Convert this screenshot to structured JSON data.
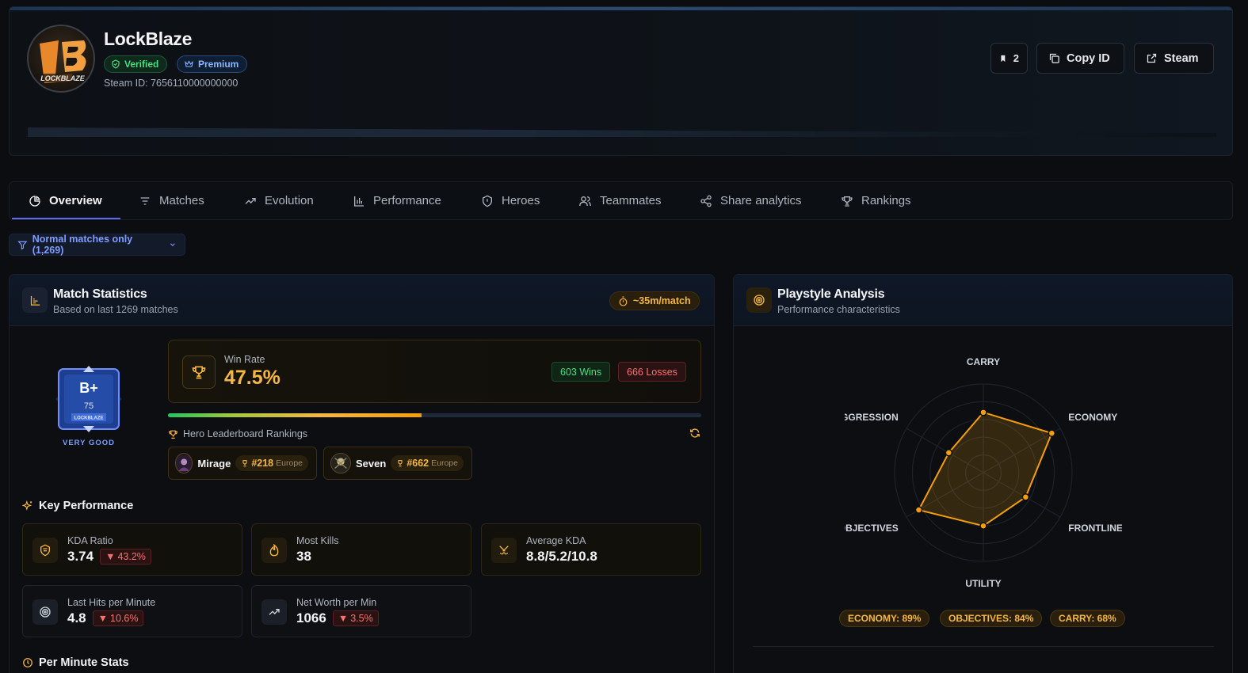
{
  "profile": {
    "name": "LockBlaze",
    "avatar_text": "LB",
    "badges": {
      "verified": "Verified",
      "premium": "Premium"
    },
    "steam_id": "Steam ID: 7656110000000000"
  },
  "header_buttons": {
    "bookmark_count": "2",
    "copy_id": "Copy ID",
    "steam": "Steam"
  },
  "tabs": [
    "Overview",
    "Matches",
    "Evolution",
    "Performance",
    "Heroes",
    "Teammates",
    "Share analytics",
    "Rankings"
  ],
  "filter": {
    "label": "Normal matches only (1,269)"
  },
  "match_stats": {
    "title": "Match Statistics",
    "subtitle": "Based on last 1269 matches",
    "avg_time": "~35m/match",
    "rank": {
      "grade": "B+",
      "score": "75",
      "label": "VERY GOOD"
    },
    "win_rate": {
      "label": "Win Rate",
      "value": "47.5%",
      "fraction": 0.475,
      "wins": "603 Wins",
      "losses": "666 Losses"
    },
    "leaderboard": {
      "title": "Hero Leaderboard Rankings",
      "heroes": [
        {
          "name": "Mirage",
          "rank": "#218",
          "region": "Europe"
        },
        {
          "name": "Seven",
          "rank": "#662",
          "region": "Europe"
        }
      ]
    },
    "key_performance": {
      "title": "Key Performance",
      "stats": [
        {
          "label": "KDA Ratio",
          "value": "3.74",
          "delta": "43.2%"
        },
        {
          "label": "Most Kills",
          "value": "38",
          "delta": ""
        },
        {
          "label": "Average KDA",
          "value": "8.8/5.2/10.8",
          "delta": ""
        },
        {
          "label": "Last Hits per Minute",
          "value": "4.8",
          "delta": "10.6%"
        },
        {
          "label": "Net Worth per Min",
          "value": "1066",
          "delta": "3.5%"
        }
      ]
    },
    "per_minute_title": "Per Minute Stats"
  },
  "playstyle": {
    "title": "Playstyle Analysis",
    "subtitle": "Performance characteristics",
    "axes": [
      {
        "label": "CARRY",
        "value": 68
      },
      {
        "label": "ECONOMY",
        "value": 89
      },
      {
        "label": "FRONTLINE",
        "value": 55
      },
      {
        "label": "UTILITY",
        "value": 60
      },
      {
        "label": "OBJECTIVES",
        "value": 84
      },
      {
        "label": "AGGRESSION",
        "value": 45
      }
    ],
    "tags": [
      "ECONOMY: 89%",
      "OBJECTIVES: 84%",
      "CARRY: 68%"
    ],
    "colors": {
      "accent": "#f59e0b"
    }
  }
}
